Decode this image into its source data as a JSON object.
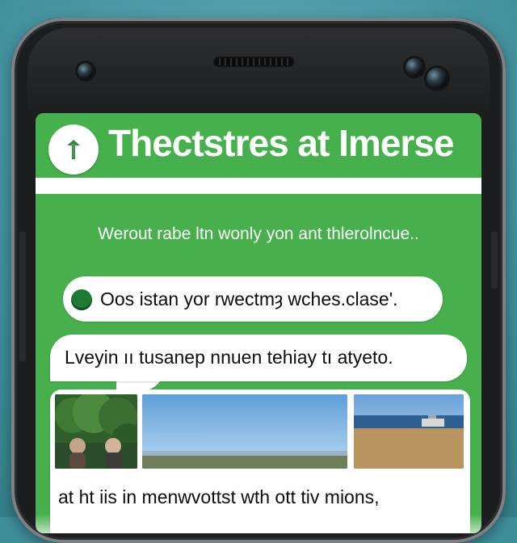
{
  "header": {
    "title": "Thectstres at Imerse",
    "logo_icon": "tree-icon"
  },
  "main": {
    "subtitle": "Werout rabe ltn wonly yon ant thlerolncue..",
    "messages": [
      {
        "text": "Oos istan yor rwectmȝ wches.clase'.",
        "icon": "green-dot-icon"
      },
      {
        "text": "Lveyin ıı tusanep nnuen tehiay tı atyeto."
      }
    ],
    "photo_card": {
      "caption": "at ht iis in menwvottst wth ott tiv mions,",
      "photos": [
        {
          "name": "forest-people-photo"
        },
        {
          "name": "horizon-sea-photo"
        },
        {
          "name": "sea-coast-photo"
        }
      ]
    }
  },
  "colors": {
    "screen_green": "#46B04D",
    "bubble_white": "#FFFFFF",
    "phone_black": "#1C1D1F",
    "background_teal": "#3F8F9B"
  }
}
